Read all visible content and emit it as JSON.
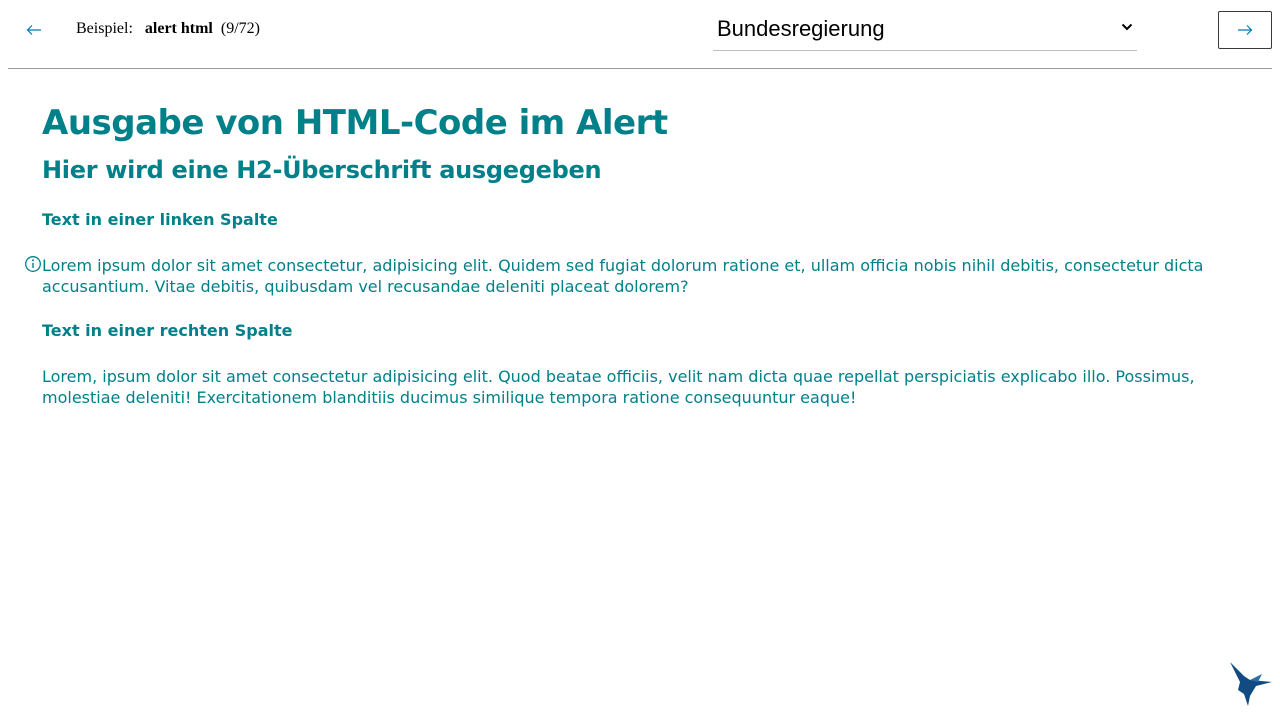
{
  "header": {
    "prev_icon": "arrow-left-icon",
    "example_prefix": "Beispiel:",
    "example_name": "alert html",
    "example_count": "(9/72)",
    "theme_selected": "Bundesregierung",
    "next_icon": "arrow-right-icon",
    "accent_color": "#0078b4"
  },
  "alert": {
    "icon": "info-circle-icon",
    "color": "#00818a",
    "heading1": "Ausgabe von HTML-Code im Alert",
    "heading2": "Hier wird eine H2-Überschrift ausgegeben",
    "left_column_title": "Text in einer linken Spalte",
    "left_column_text": "Lorem ipsum dolor sit amet consectetur, adipisicing elit. Quidem sed fugiat dolorum ratione et, ullam officia nobis nihil debitis, consectetur dicta accusantium. Vitae debitis, quibusdam vel recusandae deleniti placeat dolorem?",
    "right_column_title": "Text in einer rechten Spalte",
    "right_column_text": "Lorem, ipsum dolor sit amet consectetur adipisicing elit. Quod beatae officiis, velit nam dicta quae repellat perspiciatis explicabo illo. Possimus, molestiae deleniti! Exercitationem blanditiis ducimus similique tempora ratione consequuntur eaque!"
  },
  "footer": {
    "logo": "hummingbird-logo",
    "logo_color": "#124b82"
  }
}
